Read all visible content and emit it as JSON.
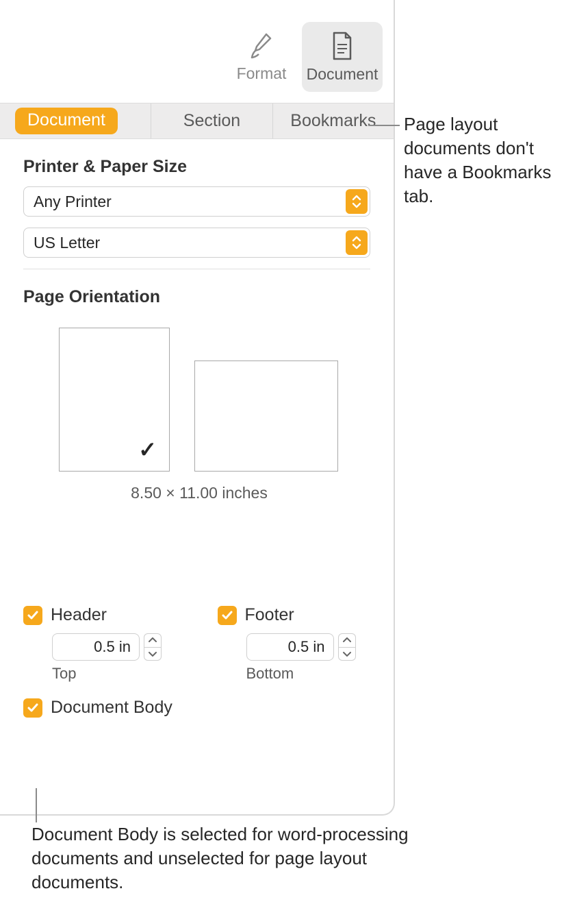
{
  "toolbar": {
    "format_label": "Format",
    "document_label": "Document"
  },
  "tabs": {
    "document": "Document",
    "section": "Section",
    "bookmarks": "Bookmarks"
  },
  "printer_section": {
    "title": "Printer & Paper Size",
    "printer": "Any Printer",
    "paper": "US Letter"
  },
  "orientation": {
    "title": "Page Orientation",
    "dimensions": "8.50 × 11.00 inches"
  },
  "header": {
    "label": "Header",
    "value": "0.5 in",
    "sublabel": "Top"
  },
  "footer": {
    "label": "Footer",
    "value": "0.5 in",
    "sublabel": "Bottom"
  },
  "document_body": {
    "label": "Document Body"
  },
  "callouts": {
    "bookmarks": "Page layout documents don't have a Bookmarks tab.",
    "docbody": "Document Body is selected for word-processing documents and unselected for page layout documents."
  }
}
